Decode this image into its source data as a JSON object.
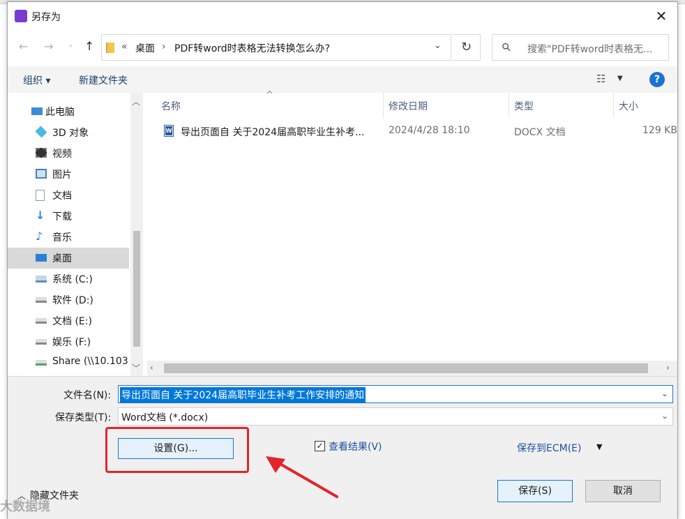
{
  "window": {
    "title": "另存为",
    "close_glyph": "✕"
  },
  "nav": {
    "back_glyph": "←",
    "forward_glyph": "→",
    "recent_glyph": "⌄",
    "up_glyph": "↑",
    "breadcrumb_prefix": "«",
    "breadcrumb": [
      "桌面",
      "PDF转word时表格无法转换怎么办?"
    ],
    "separator": "›",
    "dropdown_glyph": "⌄",
    "refresh_glyph": "↻",
    "search_placeholder": "搜索\"PDF转word时表格无...",
    "search_glyph": "⚲"
  },
  "toolbar": {
    "organize": "组织 ▾",
    "new_folder": "新建文件夹",
    "view_glyph": "☷",
    "view_caret": "▼",
    "help": "?"
  },
  "sidebar": {
    "items": [
      {
        "label": "此电脑",
        "icon": "computer-icon",
        "color": "#3c8dd8"
      },
      {
        "label": "3D 对象",
        "icon": "cube-icon",
        "color": "#4ab8e0"
      },
      {
        "label": "视频",
        "icon": "video-icon",
        "color": "#333333"
      },
      {
        "label": "图片",
        "icon": "picture-icon",
        "color": "#4a7fb5"
      },
      {
        "label": "文档",
        "icon": "document-icon",
        "color": "#8a9bb0"
      },
      {
        "label": "下载",
        "icon": "download-icon",
        "color": "#2a7fd4"
      },
      {
        "label": "音乐",
        "icon": "music-icon",
        "color": "#2a7fd4"
      },
      {
        "label": "桌面",
        "icon": "desktop-icon",
        "color": "#2a7fd4"
      },
      {
        "label": "系统 (C:)",
        "icon": "system-drive-icon",
        "color": "#5a8fc0"
      },
      {
        "label": "软件 (D:)",
        "icon": "drive-icon",
        "color": "#888888"
      },
      {
        "label": "文档 (E:)",
        "icon": "drive-icon",
        "color": "#888888"
      },
      {
        "label": "娱乐 (F:)",
        "icon": "drive-icon",
        "color": "#888888"
      },
      {
        "label": "Share (\\\\10.103",
        "icon": "network-drive-icon",
        "color": "#5aa05a"
      }
    ],
    "selected_index": 7,
    "scroll_up": "︿",
    "scroll_down": "﹀"
  },
  "filelist": {
    "columns": [
      "名称",
      "修改日期",
      "类型",
      "大小"
    ],
    "sort_glyph": "^",
    "rows": [
      {
        "name": "导出页面自 关于2024届高职毕业生补考...",
        "modified": "2024/4/28 18:10",
        "type": "DOCX 文档",
        "size": "129 KB",
        "icon_text": "W"
      }
    ],
    "scroll_left": "‹",
    "scroll_right": "›"
  },
  "form": {
    "filename_label": "文件名(N):",
    "filename_value": "导出页面自 关于2024届高职毕业生补考工作安排的通知",
    "filetype_label": "保存类型(T):",
    "filetype_value": "Word文档 (*.docx)",
    "caret_glyph": "⌄",
    "settings_button": "设置(G)...",
    "view_result_checked": "✓",
    "view_result_label": "查看结果(V)",
    "ecm_label": "保存到ECM(E)",
    "ecm_caret": "▼",
    "save_button": "保存(S)",
    "cancel_button": "取消",
    "hide_folders_glyph": "︿",
    "hide_folders_label": "隐藏文件夹"
  },
  "watermark": "大数据境",
  "colors": {
    "accent": "#0078d7",
    "highlight_red": "#e3242b",
    "link_blue": "#1e4fa0",
    "app_icon": "#7a3bd1"
  }
}
